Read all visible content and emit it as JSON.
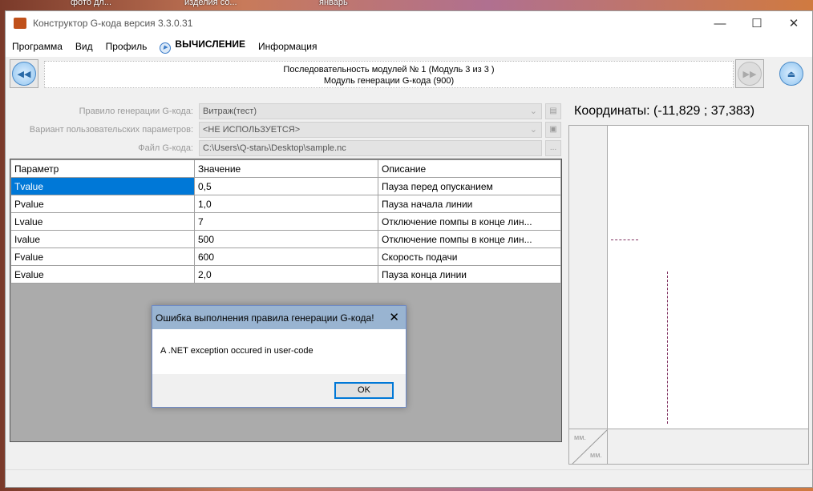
{
  "desktop": {
    "icons": [
      "фото дл...",
      "изделия со...",
      "январь"
    ]
  },
  "window": {
    "title": "Конструктор G-кода версия 3.3.0.31",
    "minimize": "—",
    "maximize": "☐",
    "close": "✕"
  },
  "menu": [
    "Программа",
    "Вид",
    "Профиль",
    "ВЫЧИСЛЕНИЕ",
    "Информация"
  ],
  "nav": {
    "line1": "Последовательность модулей № 1 (Модуль 3 из 3 )",
    "line2": "Модуль генерации G-кода (900)"
  },
  "form": {
    "rule_label": "Правило генерации G-кода:",
    "rule_value": "Витраж(тест)",
    "variant_label": "Вариант пользовательских параметров:",
    "variant_value": "<НЕ ИСПОЛЬЗУЕТСЯ>",
    "file_label": "Файл G-кода:",
    "file_value": "C:\\Users\\Q-starь\\Desktop\\sample.nc",
    "browse": "..."
  },
  "table": {
    "headers": [
      "Параметр",
      "Значение",
      "Описание"
    ],
    "rows": [
      [
        "Tvalue",
        "0,5",
        "Пауза перед опусканием"
      ],
      [
        "Pvalue",
        "1,0",
        "Пауза начала линии"
      ],
      [
        "Lvalue",
        "7",
        "Отключение помпы в конце лин..."
      ],
      [
        "Ivalue",
        "500",
        "Отключение помпы в конце лин..."
      ],
      [
        "Fvalue",
        "600",
        "Скорость подачи"
      ],
      [
        "Evalue",
        "2,0",
        "Пауза конца линии"
      ]
    ]
  },
  "dialog": {
    "title": "Ошибка выполнения правила генерации G-кода!",
    "message": "A .NET exception occured in user-code",
    "ok": "OK"
  },
  "plot": {
    "coordinates": "Координаты: (-11,829 ; 37,383)",
    "unit_y": "мм.",
    "unit_x": "мм."
  }
}
